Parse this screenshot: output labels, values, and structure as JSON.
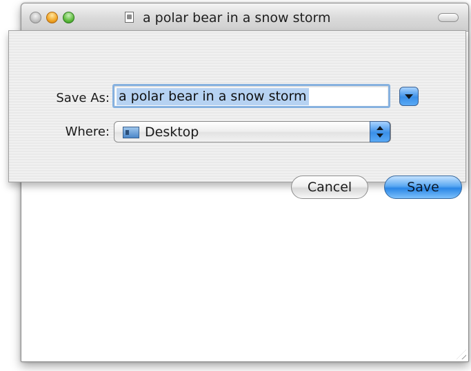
{
  "window": {
    "title": "a polar bear in a snow storm",
    "controls": [
      "close",
      "minimize",
      "zoom"
    ]
  },
  "sheet": {
    "save_as_label": "Save As:",
    "filename_value": "a polar bear in a snow storm",
    "where_label": "Where:",
    "where_value": "Desktop",
    "cancel_label": "Cancel",
    "save_label": "Save"
  },
  "icons": {
    "document": "document-icon",
    "folder": "desktop-folder-icon",
    "expand": "chevron-down-icon",
    "popup": "updown-arrows-icon"
  },
  "colors": {
    "accent_blue": "#3a8fe8",
    "focus_ring": "#86b1df",
    "selection": "#b6d2f2"
  }
}
